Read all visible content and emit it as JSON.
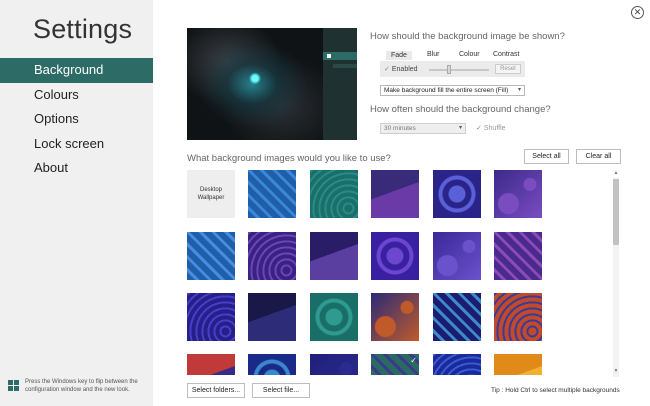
{
  "sidebar": {
    "title": "Settings",
    "items": [
      {
        "label": "Background",
        "active": true
      },
      {
        "label": "Colours",
        "active": false
      },
      {
        "label": "Options",
        "active": false
      },
      {
        "label": "Lock screen",
        "active": false
      },
      {
        "label": "About",
        "active": false
      }
    ],
    "footer_text": "Press the Windows key to flip between the configuration window and the new look.",
    "footer_icon": "windows-logo-icon"
  },
  "close_glyph": "✕",
  "display": {
    "question": "How should the background image be shown?",
    "tabs": [
      "Fade",
      "Blur",
      "Colour",
      "Contrast"
    ],
    "enabled_label": "Enabled",
    "reset_label": "Reset",
    "fit_value": "Make background fill the entire screen (Fill)"
  },
  "change": {
    "question": "How often should the background change?",
    "interval_value": "30 minutes",
    "shuffle_label": "Shuffle"
  },
  "images": {
    "question": "What background images would you like to use?",
    "select_all_label": "Select all",
    "clear_all_label": "Clear all",
    "desktop_wallpaper_label": "Desktop Wallpaper",
    "tiles": [
      {
        "row": 0,
        "col": 0,
        "kind": "text"
      },
      {
        "row": 0,
        "col": 1,
        "colors": [
          "#1e5fa8",
          "#3a86d8"
        ]
      },
      {
        "row": 0,
        "col": 2,
        "colors": [
          "#1a6e6b",
          "#2a8a86"
        ]
      },
      {
        "row": 0,
        "col": 3,
        "colors": [
          "#3a2a7a",
          "#6a3aa6"
        ]
      },
      {
        "row": 0,
        "col": 4,
        "colors": [
          "#2a2488",
          "#5a60d8"
        ]
      },
      {
        "row": 0,
        "col": 5,
        "colors": [
          "#3a2a8a",
          "#7a4cc0"
        ]
      },
      {
        "row": 1,
        "col": 0,
        "colors": [
          "#1d5fa8",
          "#4a8ae0"
        ]
      },
      {
        "row": 1,
        "col": 1,
        "colors": [
          "#3a2280",
          "#6a44b8"
        ]
      },
      {
        "row": 1,
        "col": 2,
        "colors": [
          "#2a1c66",
          "#5a3ea0"
        ]
      },
      {
        "row": 1,
        "col": 3,
        "colors": [
          "#3820a0",
          "#6c46d0"
        ]
      },
      {
        "row": 1,
        "col": 4,
        "colors": [
          "#3a2898",
          "#6a52cc"
        ]
      },
      {
        "row": 1,
        "col": 5,
        "colors": [
          "#4a2a8c",
          "#8a4ab8"
        ]
      },
      {
        "row": 2,
        "col": 0,
        "colors": [
          "#24208a",
          "#4a3cc8"
        ]
      },
      {
        "row": 2,
        "col": 1,
        "colors": [
          "#1a1848",
          "#2c2c78"
        ]
      },
      {
        "row": 2,
        "col": 2,
        "colors": [
          "#1a6e68",
          "#2e9a90"
        ]
      },
      {
        "row": 2,
        "col": 3,
        "colors": [
          "#2a2a78",
          "#c05a2a"
        ]
      },
      {
        "row": 2,
        "col": 4,
        "colors": [
          "#1c1c70",
          "#3a8acc"
        ]
      },
      {
        "row": 2,
        "col": 5,
        "colors": [
          "#c04a2a",
          "#3a3a9a"
        ]
      },
      {
        "row": 3,
        "col": 0,
        "colors": [
          "#c03a3a",
          "#3a2a88"
        ]
      },
      {
        "row": 3,
        "col": 1,
        "colors": [
          "#1a2a88",
          "#3a88cc"
        ]
      },
      {
        "row": 3,
        "col": 2,
        "colors": [
          "#20207a",
          "#2a2a90"
        ]
      },
      {
        "row": 3,
        "col": 3,
        "colors": [
          "#2a6a64",
          "#3a3a88"
        ],
        "checked": true
      },
      {
        "row": 3,
        "col": 4,
        "colors": [
          "#1a2a9a",
          "#3a5ad0"
        ]
      },
      {
        "row": 3,
        "col": 5,
        "colors": [
          "#e08a1a",
          "#f0b030"
        ]
      }
    ]
  },
  "actions": {
    "select_folders_label": "Select folders...",
    "select_file_label": "Select file...",
    "tip": "Tip : Hold Ctrl to select multiple backgrounds"
  }
}
